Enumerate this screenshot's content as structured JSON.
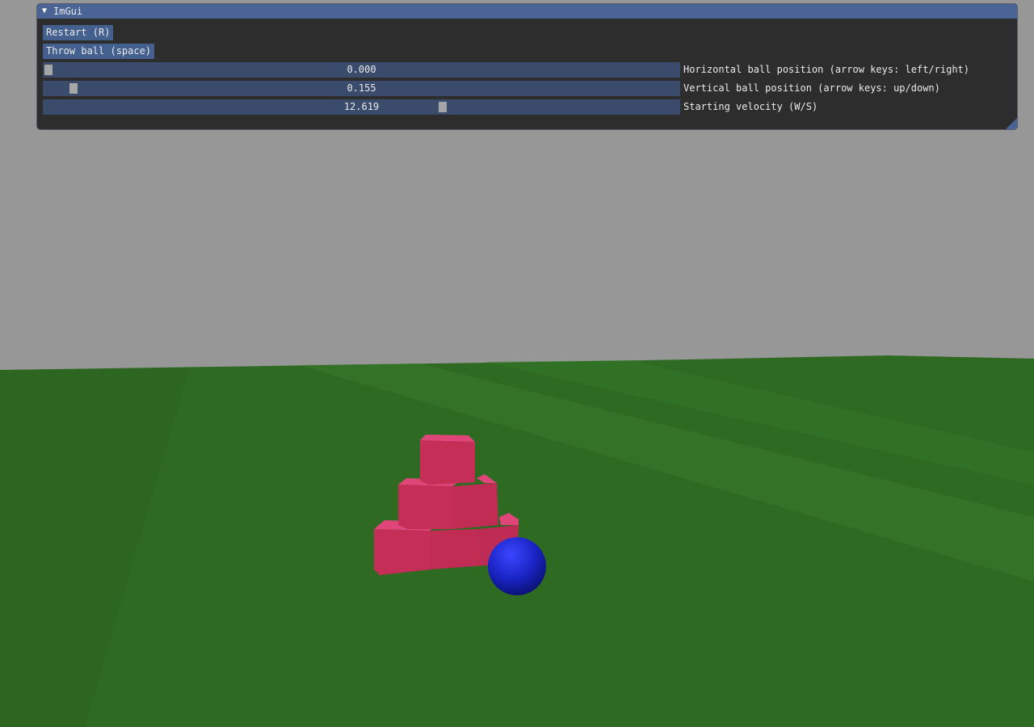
{
  "window": {
    "title": "ImGui",
    "collapse_icon": "triangle-down-icon"
  },
  "buttons": {
    "restart_label": "Restart (R)",
    "throw_label": "Throw ball (space)"
  },
  "sliders": {
    "horizontal": {
      "value_text": "0.000",
      "label": "Horizontal ball position (arrow keys: left/right)",
      "fraction": 0.0
    },
    "vertical": {
      "value_text": "0.155",
      "label": "Vertical ball position (arrow keys: up/down)",
      "fraction": 0.04
    },
    "velocity": {
      "value_text": "12.619",
      "label": "Starting velocity (W/S)",
      "fraction": 0.63
    }
  },
  "scene": {
    "sky_color": "#979797",
    "ground_color": "#2f6a23",
    "box_color": "#c9305a",
    "ball_color": "#1a24c4"
  }
}
